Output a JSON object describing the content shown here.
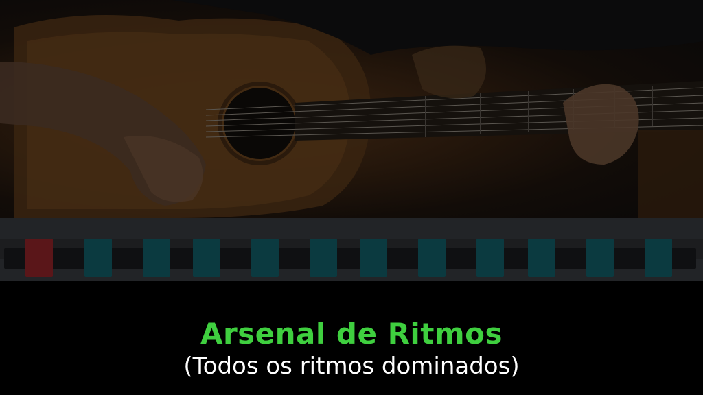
{
  "video": {
    "title": "Arsenal de Ritmos",
    "subtitle": "(Todos os ritmos dominados)"
  },
  "rhythm_strip": {
    "beats": [
      {
        "color": "#5a1619",
        "kind": "accent"
      },
      {
        "color": "#0b3a40",
        "kind": "beat"
      },
      {
        "color": "#0b3a40",
        "kind": "beat"
      },
      {
        "color": "#0b3a40",
        "kind": "beat"
      },
      {
        "color": "#0b3a40",
        "kind": "beat"
      },
      {
        "color": "#0b3a40",
        "kind": "beat"
      },
      {
        "color": "#0b3a40",
        "kind": "beat"
      },
      {
        "color": "#0b3a40",
        "kind": "beat"
      },
      {
        "color": "#0b3a40",
        "kind": "beat"
      },
      {
        "color": "#0b3a40",
        "kind": "beat"
      },
      {
        "color": "#0b3a40",
        "kind": "beat"
      },
      {
        "color": "#0b3a40",
        "kind": "beat"
      }
    ]
  },
  "colors": {
    "title": "#3fcf3f",
    "subtitle": "#ffffff",
    "background": "#000000"
  }
}
